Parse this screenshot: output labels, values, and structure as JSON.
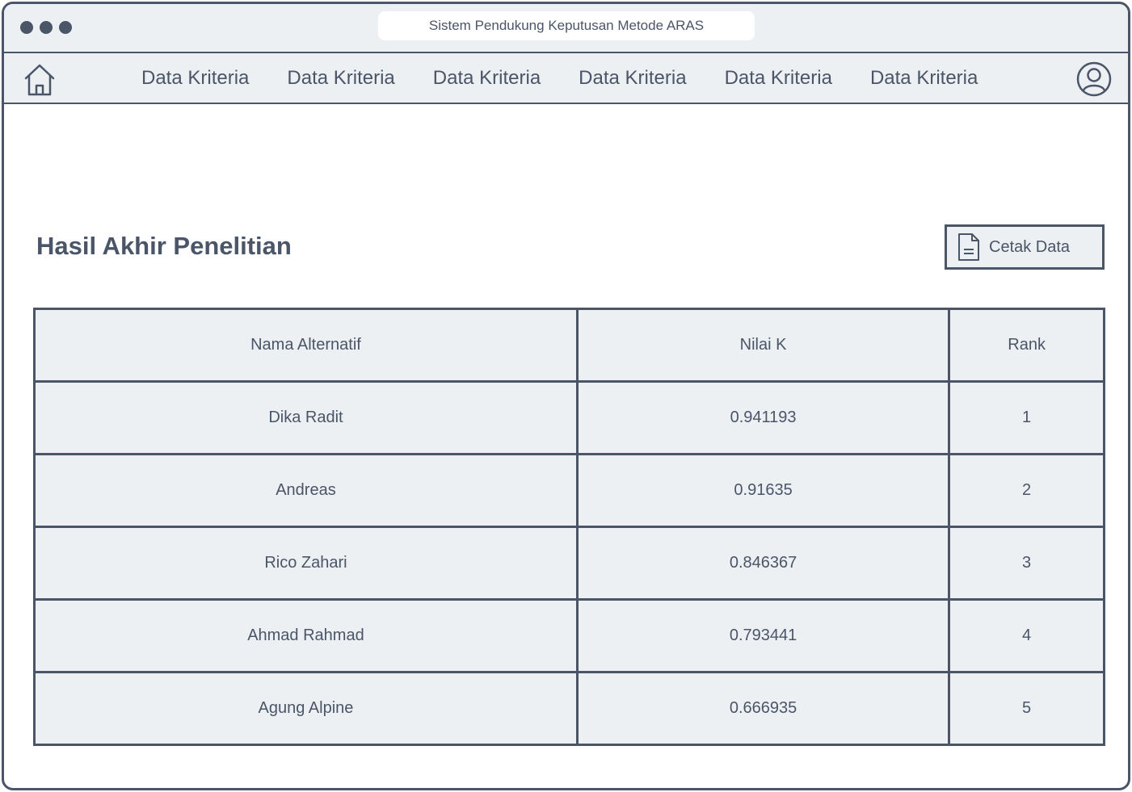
{
  "window": {
    "address_title": "Sistem Pendukung Keputusan Metode ARAS"
  },
  "nav": {
    "home_icon": "home-icon",
    "items": [
      {
        "label": "Data Kriteria"
      },
      {
        "label": "Data Kriteria"
      },
      {
        "label": "Data Kriteria"
      },
      {
        "label": "Data Kriteria"
      },
      {
        "label": "Data Kriteria"
      },
      {
        "label": "Data Kriteria"
      }
    ],
    "user_icon": "user-icon"
  },
  "main": {
    "title": "Hasil Akhir Penelitian",
    "print_button": {
      "label": "Cetak Data",
      "icon": "document-icon"
    },
    "table": {
      "headers": [
        "Nama Alternatif",
        "Nilai K",
        "Rank"
      ],
      "rows": [
        {
          "name": "Dika Radit",
          "k": "0.941193",
          "rank": "1"
        },
        {
          "name": "Andreas",
          "k": "0.91635",
          "rank": "2"
        },
        {
          "name": "Rico Zahari",
          "k": "0.846367",
          "rank": "3"
        },
        {
          "name": "Ahmad Rahmad",
          "k": "0.793441",
          "rank": "4"
        },
        {
          "name": "Agung Alpine",
          "k": "0.666935",
          "rank": "5"
        }
      ]
    }
  },
  "colors": {
    "primary": "#4a5568",
    "panel": "#edf0f3",
    "background": "#ffffff"
  }
}
